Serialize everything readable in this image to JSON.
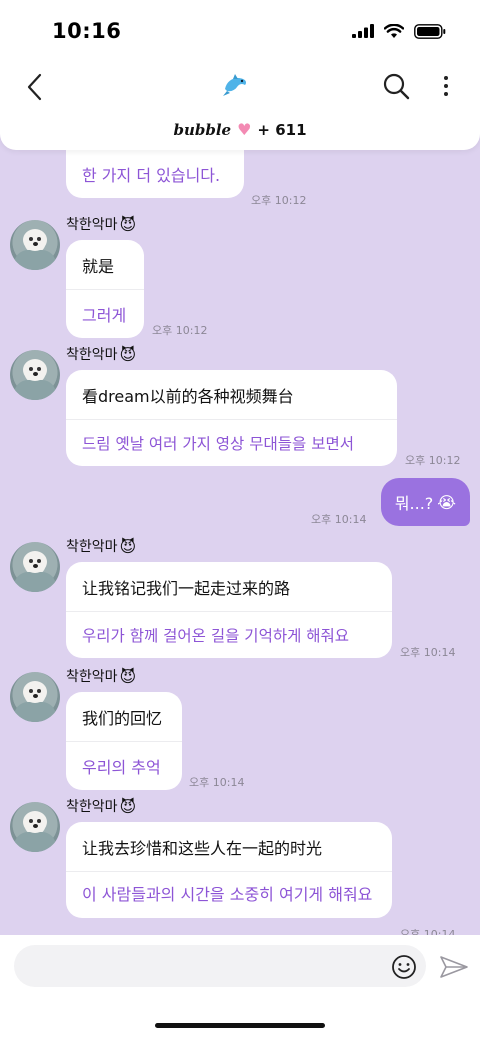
{
  "status_bar": {
    "time": "10:16"
  },
  "header": {
    "bubble_brand": "bubble",
    "bubble_count": "+ 611",
    "logo_icon": "dolphin-icon"
  },
  "messages": [
    {
      "type": "received-partial",
      "trans": "한 가지 더 있습니다.",
      "time": "오후 10:12"
    },
    {
      "type": "received",
      "sender": "착한악마",
      "orig": "就是",
      "trans": "그러게",
      "time": "오후 10:12"
    },
    {
      "type": "received",
      "sender": "착한악마",
      "orig": "看dream以前的各种视频舞台",
      "trans": "드림 옛날 여러 가지 영상 무대들을 보면서",
      "time": "오후 10:12"
    },
    {
      "type": "sent",
      "text": "뭐...?",
      "emoji": "😭",
      "time": "오후 10:14"
    },
    {
      "type": "received",
      "sender": "착한악마",
      "orig": "让我铭记我们一起走过来的路",
      "trans": "우리가 함께 걸어온 길을 기억하게 해줘요",
      "time": "오후 10:14"
    },
    {
      "type": "received",
      "sender": "착한악마",
      "orig": "我们的回忆",
      "trans": "우리의 추억",
      "time": "오후 10:14"
    },
    {
      "type": "received",
      "sender": "착한악마",
      "orig": "让我去珍惜和这些人在一起的时光",
      "trans": "이 사람들과의 시간을 소중히 여기게 해줘요",
      "time": "오후 10:14"
    }
  ],
  "sender_emoji": "😈",
  "composer": {
    "placeholder": ""
  },
  "colors": {
    "background": "#ddd2ef",
    "translation": "#8d55d6",
    "sent_bubble": "#9a72e0"
  }
}
